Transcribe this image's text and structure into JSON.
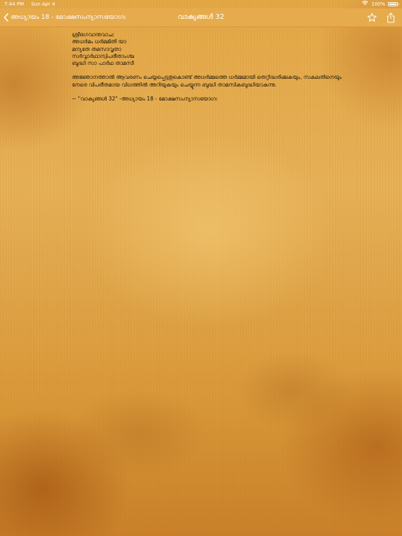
{
  "status_bar": {
    "time": "7:44 PM",
    "date": "Sun Apr 4",
    "battery": "100%",
    "battery_level": 1.0
  },
  "nav_bar": {
    "back_label": "അധ്യായം 18 - മോക്ഷസംന്യാസയോഗഃ",
    "title": "വാക്യങ്ങൾ 32",
    "star_icon": "star-icon",
    "share_icon": "share-icon",
    "tint_color": "#ffffff",
    "bar_color": "#e6ab4d"
  },
  "content": {
    "verse_lines": [
      "ശ്രീഭഗവാനുവാച:",
      "അധർമം ധർമമിതി യാ",
      "മന്യതേ തമസാവൃതാ",
      "സർവ്വാർഥാന്വിപരീതാംശ്ച",
      "ബുദ്ധി സാ പാർഥ താമസീ"
    ],
    "translation": "അജ്ഞാനത്താൽ ആവരണം ചെയ്യപ്പെട്ടതുകൊണ്ട് അധർമ്മത്തെ ധർമ്മമായി തെറ്റിദ്ധരിക്കുകയും, സകലതിനെയും നേരെ വിപരീതമായ വിധത്തിൽ അറിയുകയും ചെയ്യുന്ന ബുദ്ധി താമസികബുദ്ധിയാകുന്നു.",
    "reference": "~ \"വാക്യങ്ങൾ 32\" -അധ്യായം 18 - മോക്ഷസംന്യാസയോഗഃ",
    "text_color": "#1b1208"
  }
}
